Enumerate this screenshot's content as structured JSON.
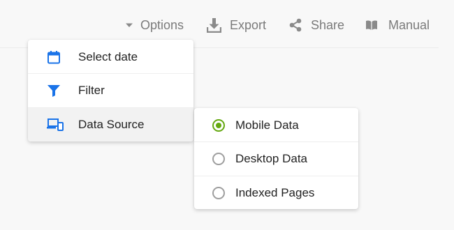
{
  "toolbar": {
    "options_label": "Options",
    "export_label": "Export",
    "share_label": "Share",
    "manual_label": "Manual"
  },
  "menu": {
    "items": [
      {
        "label": "Select date",
        "icon": "calendar-icon"
      },
      {
        "label": "Filter",
        "icon": "filter-icon"
      },
      {
        "label": "Data Source",
        "icon": "devices-icon"
      }
    ]
  },
  "submenu": {
    "items": [
      {
        "label": "Mobile Data",
        "selected": true
      },
      {
        "label": "Desktop Data",
        "selected": false
      },
      {
        "label": "Indexed Pages",
        "selected": false
      }
    ]
  },
  "colors": {
    "accent_blue": "#1a73e8",
    "radio_selected": "#64a80f",
    "toolbar_text": "#7a7a7a"
  }
}
